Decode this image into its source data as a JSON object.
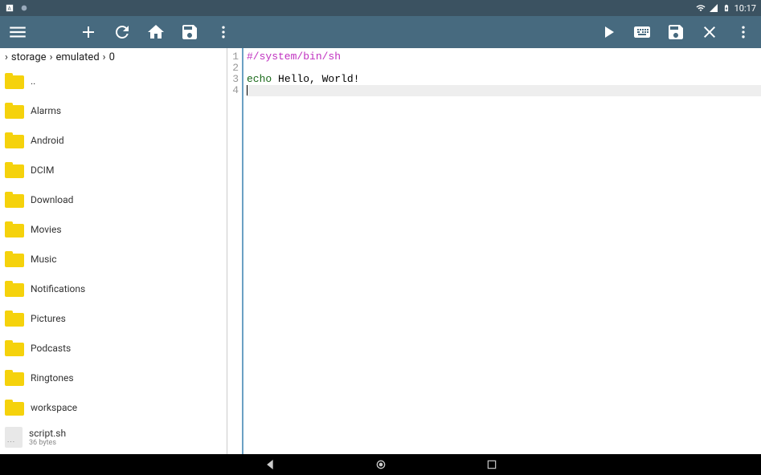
{
  "statusbar": {
    "time": "10:17"
  },
  "breadcrumb": {
    "sep": "›",
    "parts": [
      "storage",
      "emulated",
      "0"
    ]
  },
  "files": [
    {
      "name": "..",
      "type": "folder"
    },
    {
      "name": "Alarms",
      "type": "folder"
    },
    {
      "name": "Android",
      "type": "folder"
    },
    {
      "name": "DCIM",
      "type": "folder"
    },
    {
      "name": "Download",
      "type": "folder"
    },
    {
      "name": "Movies",
      "type": "folder"
    },
    {
      "name": "Music",
      "type": "folder"
    },
    {
      "name": "Notifications",
      "type": "folder"
    },
    {
      "name": "Pictures",
      "type": "folder"
    },
    {
      "name": "Podcasts",
      "type": "folder"
    },
    {
      "name": "Ringtones",
      "type": "folder"
    },
    {
      "name": "workspace",
      "type": "folder"
    },
    {
      "name": "script.sh",
      "type": "file",
      "size": "36 bytes"
    }
  ],
  "editor": {
    "lines": [
      {
        "n": "1",
        "segments": [
          {
            "cls": "c-shebang",
            "text": "#/system/bin/sh"
          }
        ]
      },
      {
        "n": "2",
        "segments": []
      },
      {
        "n": "3",
        "segments": [
          {
            "cls": "c-kw",
            "text": "echo"
          },
          {
            "cls": "c-txt",
            "text": " Hello, World!"
          }
        ]
      },
      {
        "n": "4",
        "segments": [],
        "current": true
      }
    ]
  }
}
